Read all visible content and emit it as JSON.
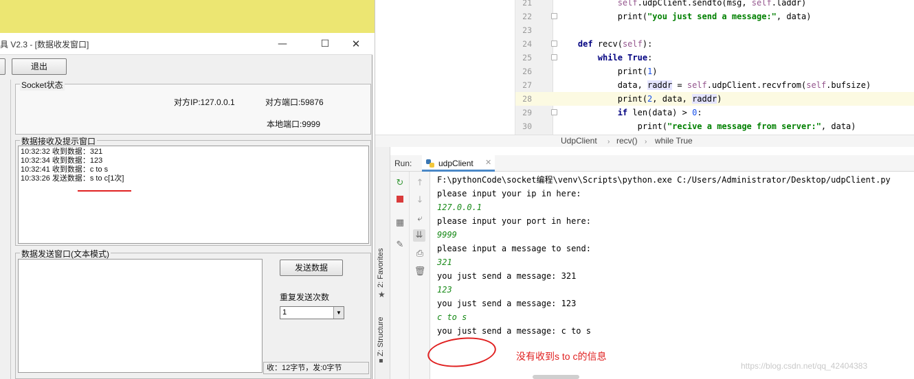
{
  "tool_window": {
    "title": "具 V2.3 - [数据收发窗口]",
    "controls": {
      "minimize": "—",
      "maximize": "☐",
      "close": "✕"
    },
    "exit_button": "退出",
    "socket_group": {
      "title": "Socket状态",
      "remote_ip": "对方IP:127.0.0.1",
      "remote_port": "对方端口:59876",
      "local_port": "本地端口:9999"
    },
    "recv_group": {
      "title": "数据接收及提示窗口",
      "lines": [
        "10:32:32 收到数据：321",
        "10:32:34 收到数据：123",
        "10:32:41 收到数据：c to s",
        "10:33:26 发送数据：s to c[1次]"
      ]
    },
    "send_group": {
      "title": "数据发送窗口(文本模式)",
      "send_button": "发送数据",
      "repeat_label": "重复发送次数",
      "repeat_value": "1",
      "status": "收：12字节，发:0字节"
    }
  },
  "ide": {
    "code_lines": [
      {
        "num": "21",
        "tokens": [
          {
            "t": "            "
          },
          {
            "t": "self",
            "c": "self"
          },
          {
            "t": ".udpClient.sendto(msg, "
          },
          {
            "t": "self",
            "c": "self"
          },
          {
            "t": ".laddr)"
          }
        ],
        "fold": false
      },
      {
        "num": "22",
        "tokens": [
          {
            "t": "            print("
          },
          {
            "t": "\"you just send a message:\"",
            "c": "str"
          },
          {
            "t": ", data)"
          }
        ],
        "fold": true
      },
      {
        "num": "23",
        "tokens": [
          {
            "t": ""
          }
        ],
        "fold": false
      },
      {
        "num": "24",
        "tokens": [
          {
            "t": "    "
          },
          {
            "t": "def",
            "c": "kw"
          },
          {
            "t": " recv("
          },
          {
            "t": "self",
            "c": "self"
          },
          {
            "t": "):"
          }
        ],
        "fold": true
      },
      {
        "num": "25",
        "tokens": [
          {
            "t": "        "
          },
          {
            "t": "while",
            "c": "kw"
          },
          {
            "t": " "
          },
          {
            "t": "True",
            "c": "kw"
          },
          {
            "t": ":"
          }
        ],
        "fold": true
      },
      {
        "num": "26",
        "tokens": [
          {
            "t": "            print("
          },
          {
            "t": "1",
            "c": "num"
          },
          {
            "t": ")"
          }
        ],
        "fold": false
      },
      {
        "num": "27",
        "tokens": [
          {
            "t": "            data, "
          },
          {
            "t": "raddr",
            "c": "hl"
          },
          {
            "t": " = "
          },
          {
            "t": "self",
            "c": "self"
          },
          {
            "t": ".udpClient.recvfrom("
          },
          {
            "t": "self",
            "c": "self"
          },
          {
            "t": ".bufsize)"
          }
        ],
        "fold": false
      },
      {
        "num": "28",
        "tokens": [
          {
            "t": "            print("
          },
          {
            "t": "2",
            "c": "num"
          },
          {
            "t": ", data, "
          },
          {
            "t": "raddr",
            "c": "hl"
          },
          {
            "t": ")"
          }
        ],
        "fold": false,
        "current": true
      },
      {
        "num": "29",
        "tokens": [
          {
            "t": "            "
          },
          {
            "t": "if",
            "c": "kw"
          },
          {
            "t": " len(data) > "
          },
          {
            "t": "0",
            "c": "num"
          },
          {
            "t": ":"
          }
        ],
        "fold": true
      },
      {
        "num": "30",
        "tokens": [
          {
            "t": "                print("
          },
          {
            "t": "\"recive a message from server:\"",
            "c": "str"
          },
          {
            "t": ", data)"
          }
        ],
        "fold": false
      }
    ],
    "breadcrumb": [
      "UdpClient",
      "recv()",
      "while True"
    ],
    "run_label": "Run:",
    "run_tab": "udpClient",
    "side_tabs": {
      "favorites": "2: Favorites",
      "structure": "Z: Structure"
    },
    "console_lines": [
      {
        "text": "F:\\pythonCode\\socket编程\\venv\\Scripts\\python.exe C:/Users/Administrator/Desktop/udpClient.py",
        "input": false
      },
      {
        "text": "please input your ip in here:",
        "input": false
      },
      {
        "text": "127.0.0.1",
        "input": true
      },
      {
        "text": "please input your port in here:",
        "input": false
      },
      {
        "text": "9999",
        "input": true
      },
      {
        "text": "please input a message to send:",
        "input": false
      },
      {
        "text": "321",
        "input": true
      },
      {
        "text": "you just send a message: 321",
        "input": false
      },
      {
        "text": "123",
        "input": true
      },
      {
        "text": "you just send a message: 123",
        "input": false
      },
      {
        "text": "c to s",
        "input": true
      },
      {
        "text": "you just send a message: c to s",
        "input": false
      }
    ]
  },
  "annotation_text": "没有收到s to c的信息",
  "watermark": "https://blog.csdn.net/qq_42404383",
  "colors": {
    "annotation": "#e02020",
    "keyword": "#000080",
    "string": "#008000",
    "console_input": "#188a18",
    "title_bar_bg": "#ece672"
  }
}
